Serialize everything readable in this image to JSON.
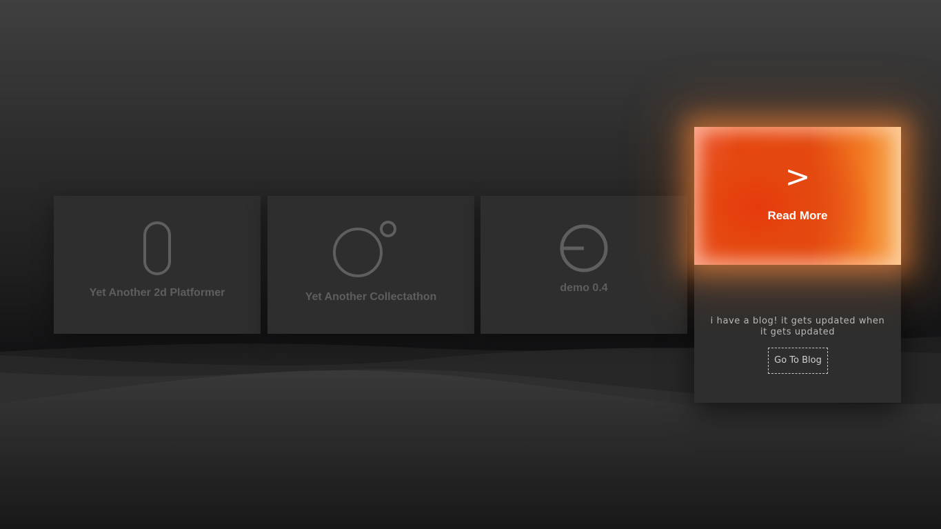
{
  "projects": [
    {
      "title": "Yet Another 2d Platformer",
      "icon": "capsule-icon"
    },
    {
      "title": "Yet Another Collectathon",
      "icon": "circles-icon"
    },
    {
      "title": "demo 0.4",
      "icon": "power-dial-icon"
    }
  ],
  "blog": {
    "hero_arrow": ">",
    "hero_label": "Read More",
    "description": "i have a blog! it gets updated when it gets updated",
    "button_label": "Go To Blog"
  },
  "colors": {
    "accent_orange": "#e7430f",
    "card_bg": "#2e2e2e",
    "icon_stroke": "#5f5f5f"
  }
}
